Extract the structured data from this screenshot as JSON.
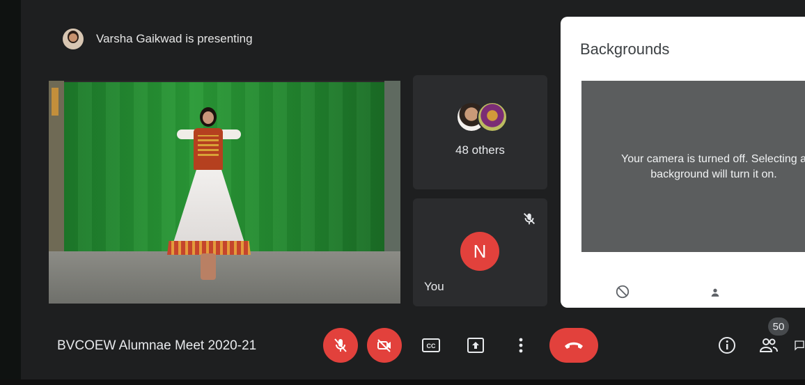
{
  "presenter": {
    "text": "Varsha Gaikwad is presenting"
  },
  "grid": {
    "others_label": "48 others",
    "you": {
      "label": "You",
      "initial": "N"
    }
  },
  "backgrounds_panel": {
    "title": "Backgrounds",
    "notice": "Your camera is turned off. Selecting a background will turn it on."
  },
  "meeting": {
    "title": "BVCOEW Alumnae Meet 2020-21"
  },
  "controls": {
    "mic": {
      "icon": "mic-off-icon",
      "state": "off"
    },
    "camera": {
      "icon": "camera-off-icon",
      "state": "off"
    },
    "captions": {
      "icon": "closed-captions-icon",
      "label": "CC"
    },
    "present": {
      "icon": "present-screen-icon"
    },
    "more": {
      "icon": "more-vert-icon"
    },
    "end_call": {
      "icon": "call-end-icon"
    },
    "info": {
      "icon": "info-icon"
    },
    "people": {
      "icon": "people-icon",
      "count": "50"
    },
    "chat": {
      "icon": "chat-icon"
    }
  },
  "colors": {
    "danger": "#e2413c",
    "surface": "#2b2c2e",
    "background": "#1e1f20"
  }
}
